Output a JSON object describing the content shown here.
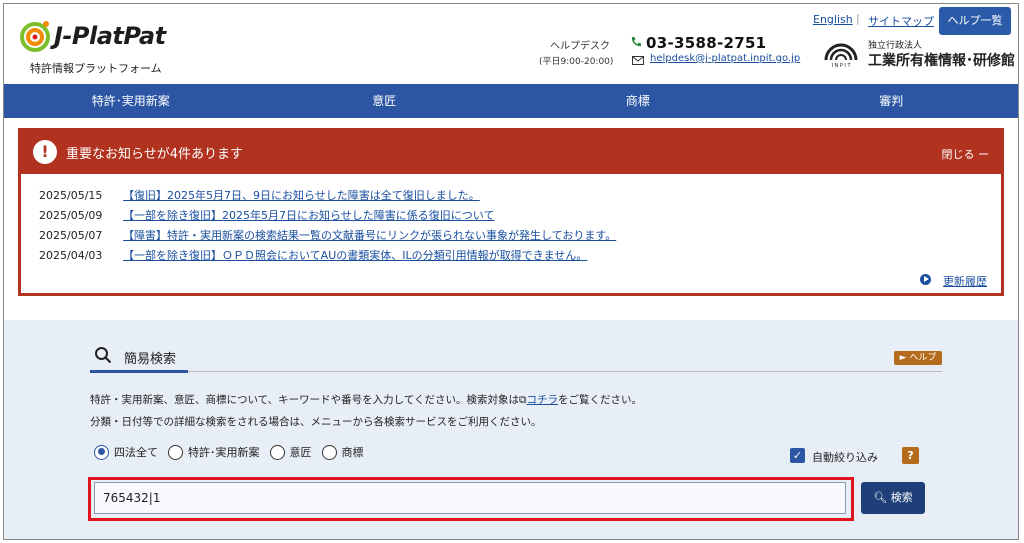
{
  "header": {
    "logo_text": "J-PlatPat",
    "logo_sub": "特許情報プラットフォーム",
    "helpdesk_label": "ヘルプデスク",
    "helpdesk_hours": "(平日9:00-20:00)",
    "phone": "03-3588-2751",
    "email": "helpdesk@j-platpat.inpit.go.jp",
    "english": "English",
    "separator": "|",
    "sitemap": "サイトマップ",
    "help_list": "ヘルプ一覧",
    "inpit_small": "独立行政法人",
    "inpit_name": "工業所有権情報･研修館"
  },
  "nav": {
    "items": [
      "特許･実用新案",
      "意匠",
      "商標",
      "審判"
    ]
  },
  "notice": {
    "title": "重要なお知らせが4件あります",
    "close": "閉じる ー",
    "items": [
      {
        "date": "2025/05/15",
        "text": "【復旧】2025年5月7日、9日にお知らせした障害は全て復旧しました。"
      },
      {
        "date": "2025/05/09",
        "text": "【一部を除き復旧】2025年5月7日にお知らせした障害に係る復旧について"
      },
      {
        "date": "2025/05/07",
        "text": "【障害】特許・実用新案の検索結果一覧の文献番号にリンクが張られない事象が発生しております。"
      },
      {
        "date": "2025/04/03",
        "text": "【一部を除き復旧】ＯＰＤ照会においてAUの書類実体、ILの分類引用情報が取得できません。"
      }
    ],
    "history": "更新履歴"
  },
  "search": {
    "title": "簡易検索",
    "help": "► ヘルプ",
    "desc1_a": "特許・実用新案、意匠、商標について、キーワードや番号を入力してください。検索対象は",
    "desc1_link": "コチラ",
    "desc1_b": "をご覧ください。",
    "desc2": "分類・日付等での詳細な検索をされる場合は、メニューから各検索サービスをご利用ください。",
    "radios": [
      "四法全て",
      "特許･実用新案",
      "意匠",
      "商標"
    ],
    "auto_narrow": "自動絞り込み",
    "qmark": "?",
    "input_value": "765432|1",
    "button": "検索"
  },
  "colors": {
    "nav": "#2c56a4",
    "notice": "#b1321f",
    "highlight": "#e0141e",
    "search_button": "#1e3f78"
  }
}
